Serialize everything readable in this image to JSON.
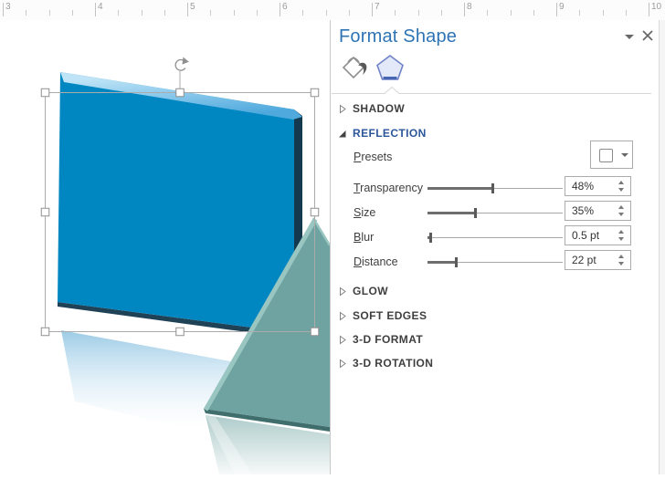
{
  "ruler": {
    "numbers": [
      "3",
      "4",
      "5",
      "6",
      "7",
      "8",
      "9",
      "10"
    ]
  },
  "panel": {
    "title": "Format Shape",
    "window_icons": {
      "dropdown": "caret-down-icon",
      "close": "close-icon"
    },
    "tabs": [
      {
        "name": "fill-line",
        "icon": "paint-bucket-icon",
        "selected": false
      },
      {
        "name": "effects",
        "icon": "pentagon-effects-icon",
        "selected": true
      }
    ],
    "sections": [
      {
        "label": "SHADOW",
        "expanded": false
      },
      {
        "label": "REFLECTION",
        "expanded": true
      },
      {
        "label": "GLOW",
        "expanded": false
      },
      {
        "label": "SOFT EDGES",
        "expanded": false
      },
      {
        "label": "3-D FORMAT",
        "expanded": false
      },
      {
        "label": "3-D ROTATION",
        "expanded": false
      }
    ],
    "reflection": {
      "presets_label": "Presets",
      "presets_icon": "reflection-preset-icon",
      "sliders": [
        {
          "label": "Transparency",
          "value": "48%",
          "percent": 48
        },
        {
          "label": "Size",
          "value": "35%",
          "percent": 35
        },
        {
          "label": "Blur",
          "value": "0.5 pt",
          "percent": 2
        },
        {
          "label": "Distance",
          "value": "22 pt",
          "percent": 21
        }
      ]
    }
  },
  "canvas": {
    "shapes": [
      {
        "name": "beveled-blue-quad",
        "selected": true,
        "effects": "3-d bevel + reflection"
      },
      {
        "name": "beveled-teal-triangle",
        "selected": false,
        "effects": "3-d bevel + reflection"
      }
    ]
  },
  "colors": {
    "title-blue": "#2e74b5",
    "section-blue": "#2b579a",
    "shape-blue": "#0087c2",
    "shape-blue-light": "#bfe4f7",
    "shape-blue-mid": "#4fa9dd",
    "shape-blue-dark": "#14384e",
    "shape-teal": "#6fa3a1",
    "shape-teal-light": "#9ac6c2",
    "shape-teal-dark": "#3f6e6c"
  }
}
